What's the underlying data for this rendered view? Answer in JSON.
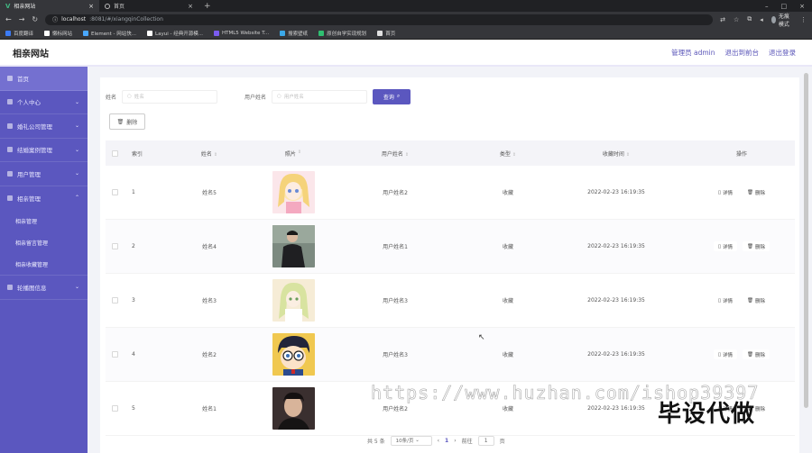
{
  "browser": {
    "tabs": [
      {
        "title": "相亲网站",
        "active": true,
        "icon": "vue-icon"
      },
      {
        "title": "首页",
        "active": false,
        "icon": "globe-icon"
      }
    ],
    "url_host": "localhost",
    "url_path": ":8081/#/xiangqinCollection",
    "profile_label": "无痕模式",
    "bookmarks": [
      {
        "label": "百度翻译",
        "color": "#3b7bf5"
      },
      {
        "label": "懒标网站",
        "color": "#ffffff"
      },
      {
        "label": "Element - 网站快...",
        "color": "#4aa8ff"
      },
      {
        "label": "Layui - 经典开源模...",
        "color": "#ffffff"
      },
      {
        "label": "HTML5 Website T...",
        "color": "#7a5cf0"
      },
      {
        "label": "搜索壁纸",
        "color": "#3ba8e8"
      },
      {
        "label": "原创自学实现规划",
        "color": "#2fbf71"
      },
      {
        "label": "首页",
        "color": "#e0e0e0"
      }
    ]
  },
  "header": {
    "title": "相亲网站",
    "admin_label": "管理员 admin",
    "back_label": "退出到前台",
    "logout_label": "退出登录"
  },
  "sidebar": {
    "items": [
      {
        "label": "首页",
        "has_chevron": false
      },
      {
        "label": "个人中心",
        "has_chevron": true
      },
      {
        "label": "婚礼公司管理",
        "has_chevron": true
      },
      {
        "label": "结婚案例管理",
        "has_chevron": true
      },
      {
        "label": "用户管理",
        "has_chevron": true
      },
      {
        "label": "相亲管理",
        "has_chevron": true,
        "open": true
      },
      {
        "label": "轮播图信息",
        "has_chevron": true
      }
    ],
    "subitems": [
      {
        "label": "相亲管理"
      },
      {
        "label": "相亲留言管理"
      },
      {
        "label": "相亲收藏管理"
      }
    ],
    "colors": {
      "bg": "#5b57bf",
      "active": "#7470d0"
    }
  },
  "search": {
    "name_label": "姓名",
    "name_placeholder": "姓名",
    "user_label": "用户姓名",
    "user_placeholder": "用户姓名",
    "query_label": "查询"
  },
  "toolbar": {
    "delete_label": "删除"
  },
  "table": {
    "headers": {
      "index": "索引",
      "name": "姓名",
      "photo": "照片",
      "user": "用户姓名",
      "type": "类型",
      "time": "收藏时间",
      "ops": "操作"
    },
    "detail_label": "详情",
    "delete_label": "删除",
    "rows": [
      {
        "index": "1",
        "name": "姓名5",
        "user": "用户姓名2",
        "type": "收藏",
        "time": "2022-02-23 16:19:35",
        "photo": "anime-girl-blonde"
      },
      {
        "index": "2",
        "name": "姓名4",
        "user": "用户姓名1",
        "type": "收藏",
        "time": "2022-02-23 16:19:35",
        "photo": "man-street"
      },
      {
        "index": "3",
        "name": "姓名3",
        "user": "用户姓名3",
        "type": "收藏",
        "time": "2022-02-23 16:19:35",
        "photo": "anime-girl-green"
      },
      {
        "index": "4",
        "name": "姓名2",
        "user": "用户姓名3",
        "type": "收藏",
        "time": "2022-02-23 16:19:35",
        "photo": "anime-boy-glasses"
      },
      {
        "index": "5",
        "name": "姓名1",
        "user": "用户姓名2",
        "type": "收藏",
        "time": "2022-02-23 16:19:35",
        "photo": "man-portrait"
      }
    ]
  },
  "pagination": {
    "total_label": "共 5 条",
    "size_label": "10条/页",
    "current_page": "1",
    "jump_label": "前往",
    "jump_value": "1",
    "page_unit": "页"
  },
  "overlay": {
    "watermark": "https://www.huzhan.com/ishop39397",
    "stamp": "毕设代做"
  }
}
